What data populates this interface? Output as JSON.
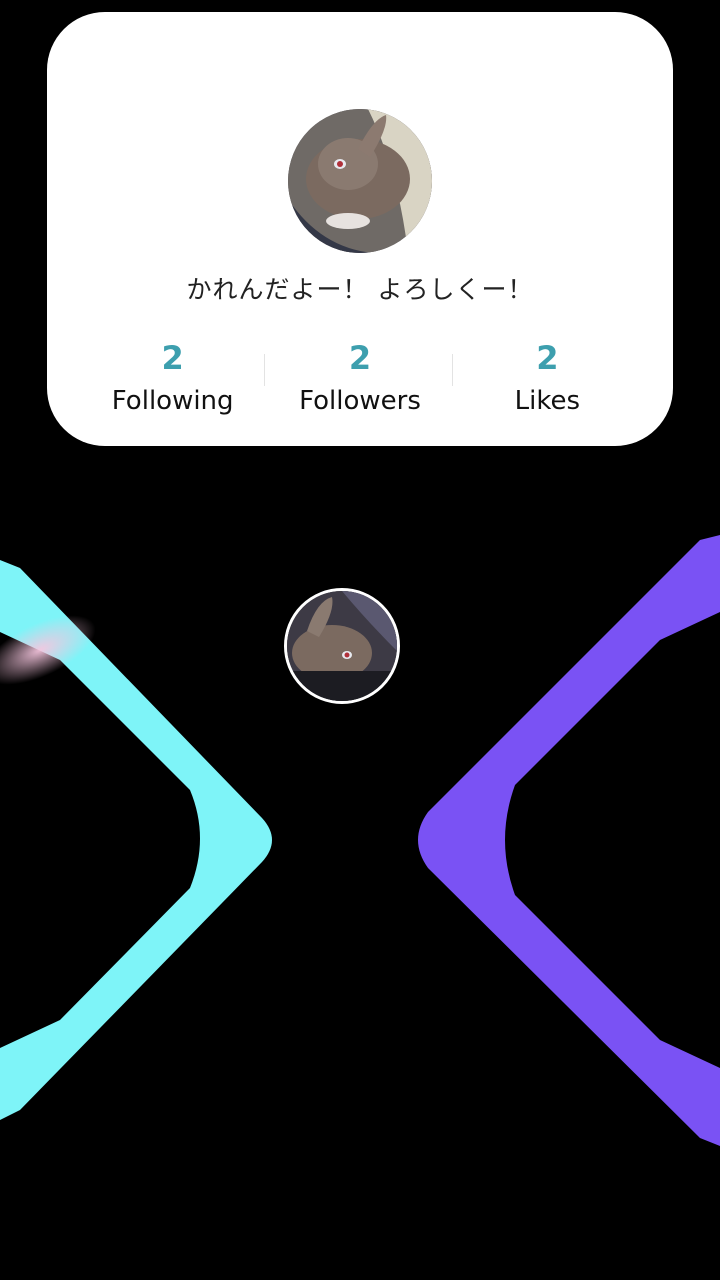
{
  "profile": {
    "bio": "かれんだよー！ よろしくー！",
    "avatar_icon": "rabbit-photo-icon",
    "stats": [
      {
        "value": "2",
        "label": "Following"
      },
      {
        "value": "2",
        "label": "Followers"
      },
      {
        "value": "2",
        "label": "Likes"
      }
    ]
  },
  "overlay": {
    "avatar_icon": "rabbit-photo-icon",
    "left_shape_icon": "cyan-chevron-shape",
    "right_shape_icon": "purple-chevron-shape"
  },
  "colors": {
    "background": "#000000",
    "card": "#ffffff",
    "stat_value": "#3d9fae",
    "left_shape": "#7ef4f8",
    "right_shape": "#7a52f4"
  }
}
